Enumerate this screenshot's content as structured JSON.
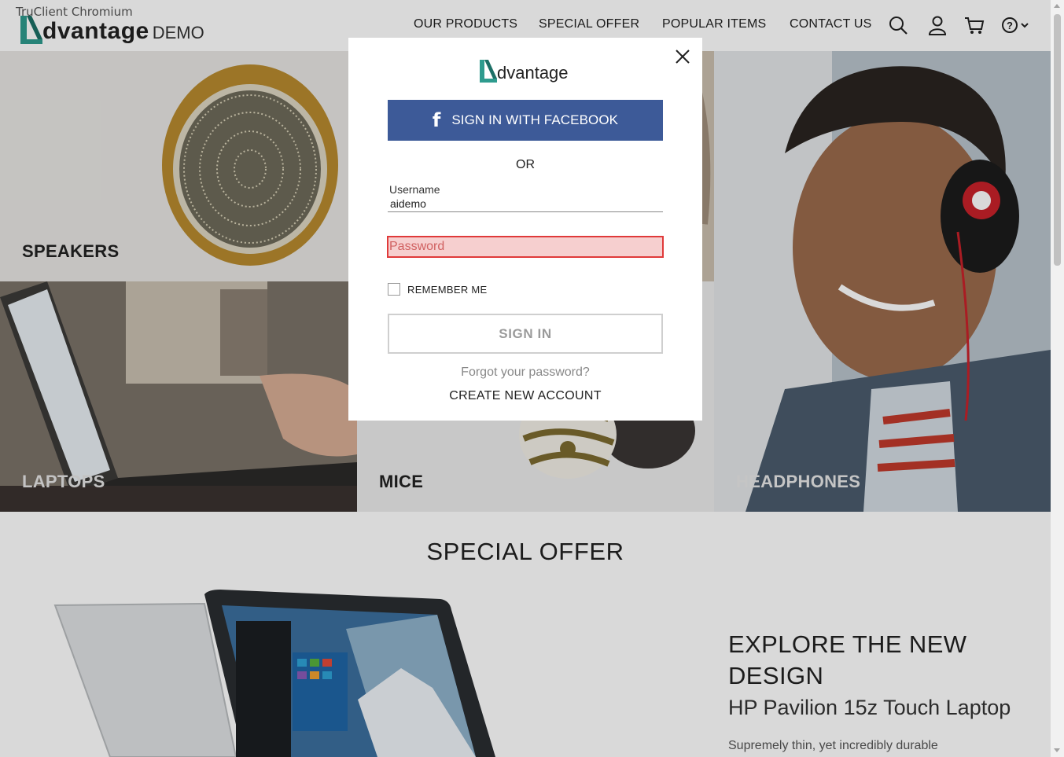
{
  "browser": {
    "label": "TruClient Chromium"
  },
  "header": {
    "logo_word": "dvantage",
    "logo_suffix": "DEMO",
    "nav": [
      "OUR PRODUCTS",
      "SPECIAL OFFER",
      "POPULAR ITEMS",
      "CONTACT US"
    ],
    "icons": [
      "search-icon",
      "user-icon",
      "cart-icon",
      "help-icon"
    ]
  },
  "categories": {
    "speakers": "SPEAKERS",
    "laptops": "LAPTOPS",
    "mice": "MICE",
    "headphones": "HEADPHONES"
  },
  "special_offer": {
    "title": "SPECIAL OFFER",
    "headline": "EXPLORE THE NEW DESIGN",
    "product": "HP Pavilion 15z Touch Laptop",
    "description": "Supremely thin, yet incredibly durable"
  },
  "login_modal": {
    "logo_word": "dvantage",
    "facebook_icon": "f",
    "facebook_label": "SIGN IN WITH FACEBOOK",
    "or_text": "OR",
    "username_label": "Username",
    "username_value": "aidemo",
    "password_placeholder": "Password",
    "remember_label": "REMEMBER ME",
    "remember_checked": false,
    "signin_label": "SIGN IN",
    "forgot_label": "Forgot your password?",
    "create_label": "CREATE NEW ACCOUNT"
  },
  "colors": {
    "brand_teal": "#2e9b8e",
    "facebook_blue": "#3d5a98",
    "error_red": "#e03a3a",
    "error_fill": "#f6cfcf"
  }
}
